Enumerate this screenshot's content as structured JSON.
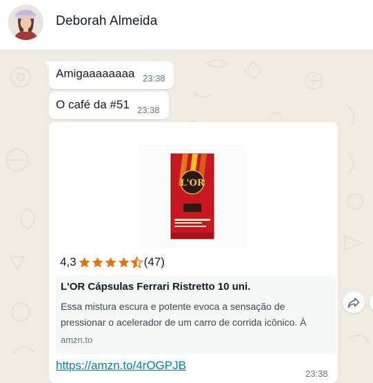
{
  "header": {
    "contact_name": "Deborah Almeida",
    "avatar_icon": "contact-avatar"
  },
  "messages": [
    {
      "text": "Amigaaaaaaaa",
      "time": "23:38"
    },
    {
      "text": "O café da #51",
      "time": "23:38"
    }
  ],
  "link_preview": {
    "rating_value": "4,3",
    "rating_stars": 4.3,
    "rating_count": "(47)",
    "title": "L'OR Cápsulas Ferrari Ristretto 10 uni.",
    "description": "Essa mistura escura e potente evoca a sensação de pressionar o acelerador de um carro de corrida icônico. À",
    "domain": "amzn.to",
    "url": "https://amzn.to/4rOGPJB",
    "time": "23:38",
    "product_brand": "L'OR"
  },
  "colors": {
    "chat_bg": "#efeae2",
    "bubble_bg": "#ffffff",
    "link": "#027eb5",
    "star": "#e8710a",
    "timestamp": "#667781"
  }
}
